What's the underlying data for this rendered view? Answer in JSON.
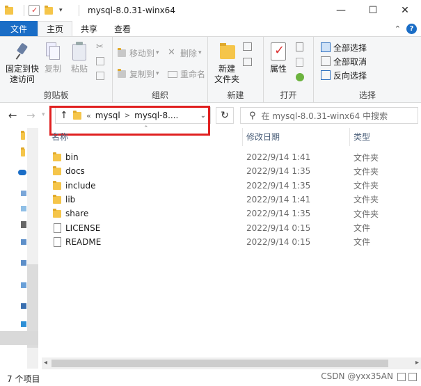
{
  "window": {
    "title": "mysql-8.0.31-winx64",
    "controls": {
      "minimize": "—",
      "maximize": "☐",
      "close": "✕"
    }
  },
  "ribbon_tabs": {
    "file": "文件",
    "home": "主页",
    "share": "共享",
    "view": "查看"
  },
  "ribbon": {
    "clipboard": {
      "label": "剪贴板",
      "pin_line1": "固定到快",
      "pin_line2": "速访问",
      "copy": "复制",
      "paste": "粘贴"
    },
    "organize": {
      "label": "组织",
      "move_to": "移动到",
      "copy_to": "复制到",
      "delete": "删除",
      "rename": "重命名"
    },
    "new": {
      "label": "新建",
      "new_folder_line1": "新建",
      "new_folder_line2": "文件夹"
    },
    "open": {
      "label": "打开",
      "properties": "属性"
    },
    "select": {
      "label": "选择",
      "select_all": "全部选择",
      "select_none": "全部取消",
      "invert": "反向选择"
    }
  },
  "address": {
    "overflow": "«",
    "crumbs": [
      "mysql",
      "mysql-8...."
    ],
    "search_placeholder": "在 mysql-8.0.31-winx64 中搜索"
  },
  "columns": {
    "name": "名称",
    "modified": "修改日期",
    "type": "类型"
  },
  "files": [
    {
      "name": "bin",
      "modified": "2022/9/14 1:41",
      "type": "文件夹",
      "icon": "folder-icon"
    },
    {
      "name": "docs",
      "modified": "2022/9/14 1:35",
      "type": "文件夹",
      "icon": "folder-icon"
    },
    {
      "name": "include",
      "modified": "2022/9/14 1:35",
      "type": "文件夹",
      "icon": "folder-icon"
    },
    {
      "name": "lib",
      "modified": "2022/9/14 1:41",
      "type": "文件夹",
      "icon": "folder-icon"
    },
    {
      "name": "share",
      "modified": "2022/9/14 1:35",
      "type": "文件夹",
      "icon": "folder-icon"
    },
    {
      "name": "LICENSE",
      "modified": "2022/9/14 0:15",
      "type": "文件",
      "icon": "file-icon"
    },
    {
      "name": "README",
      "modified": "2022/9/14 0:15",
      "type": "文件",
      "icon": "file-icon"
    }
  ],
  "status": {
    "count": "7 个项目",
    "watermark": "CSDN @yxx35AN"
  },
  "colors": {
    "accent": "#1a6dc6",
    "highlight_box": "#e02020",
    "folder": "#f5c54a"
  }
}
